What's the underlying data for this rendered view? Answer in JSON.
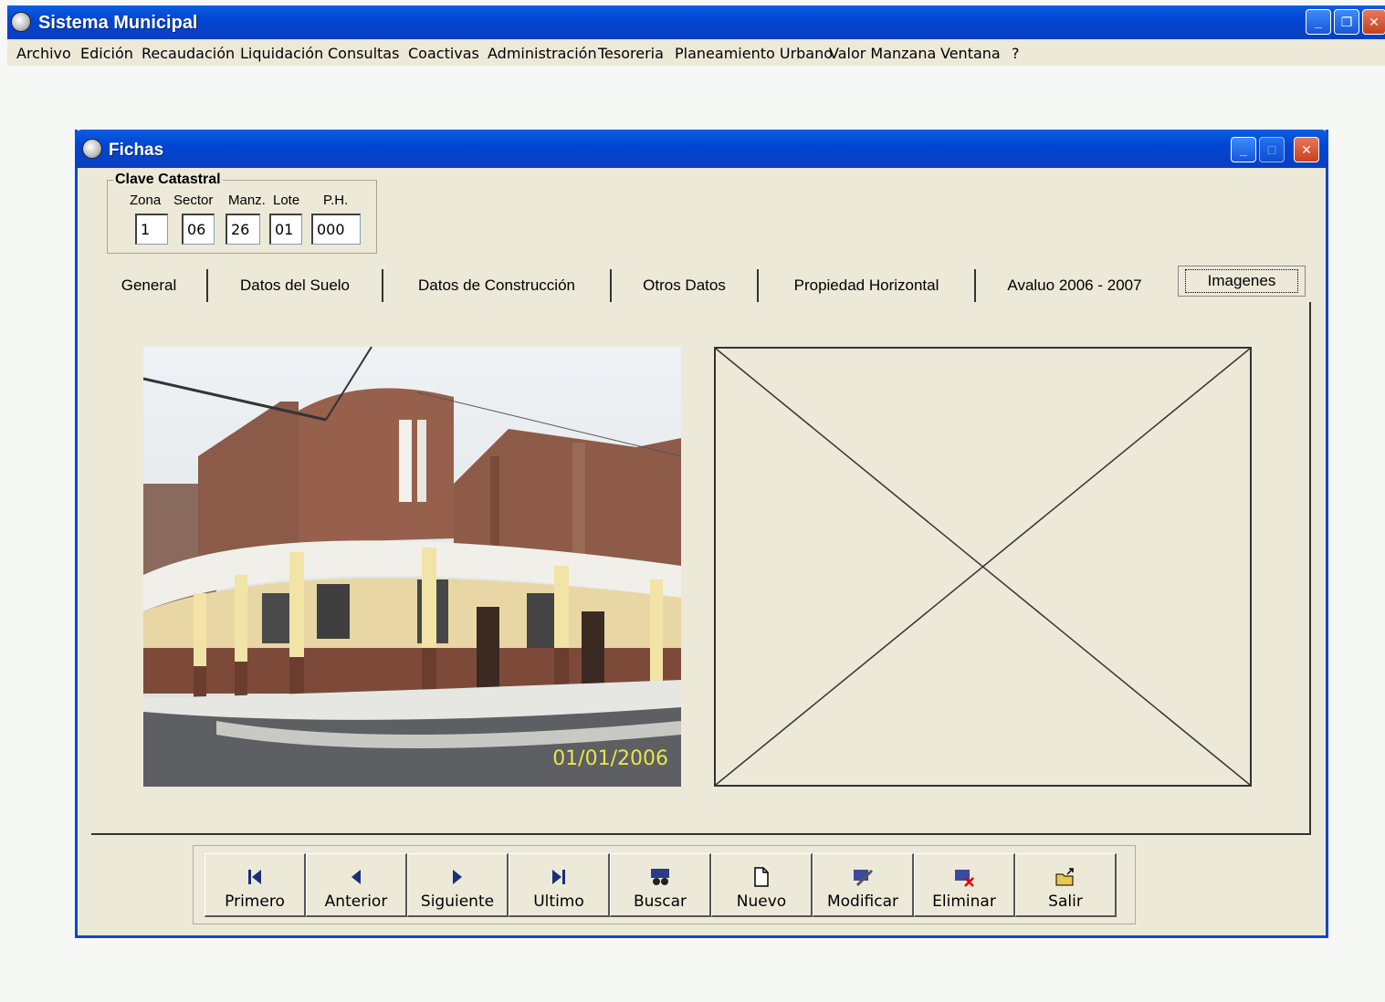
{
  "app": {
    "title": "Sistema Municipal"
  },
  "menu": [
    "Archivo",
    "Edición",
    "Recaudación",
    "Liquidación",
    "Consultas",
    "Coactivas",
    "Administración",
    "Tesoreria",
    "Planeamiento Urbano",
    "Valor Manzana",
    "Ventana",
    "?"
  ],
  "window": {
    "title": "Fichas"
  },
  "clave": {
    "legend": "Clave Catastral",
    "labels": {
      "zona": "Zona",
      "sector": "Sector",
      "manzana": "Manz.",
      "lote": "Lote",
      "ph": "P.H."
    },
    "values": {
      "zona": "1",
      "sector": "06",
      "manzana": "26",
      "lote": "01",
      "ph": "000"
    }
  },
  "tabs": [
    "General",
    "Datos del Suelo",
    "Datos de Construcción",
    "Otros Datos",
    "Propiedad  Horizontal",
    "Avaluo 2006 - 2007",
    "Imagenes"
  ],
  "active_tab": "Imagenes",
  "photo": {
    "date_stamp": "01/01/2006"
  },
  "toolbar": {
    "primero": "Primero",
    "anterior": "Anterior",
    "siguiente": "Siguiente",
    "ultimo": "Ultimo",
    "buscar": "Buscar",
    "nuevo": "Nuevo",
    "modificar": "Modificar",
    "eliminar": "Eliminar",
    "salir": "Salir"
  },
  "colors": {
    "titlebar": "#0046d5",
    "face": "#ece9d8",
    "desktop": "#f6f8f6"
  }
}
